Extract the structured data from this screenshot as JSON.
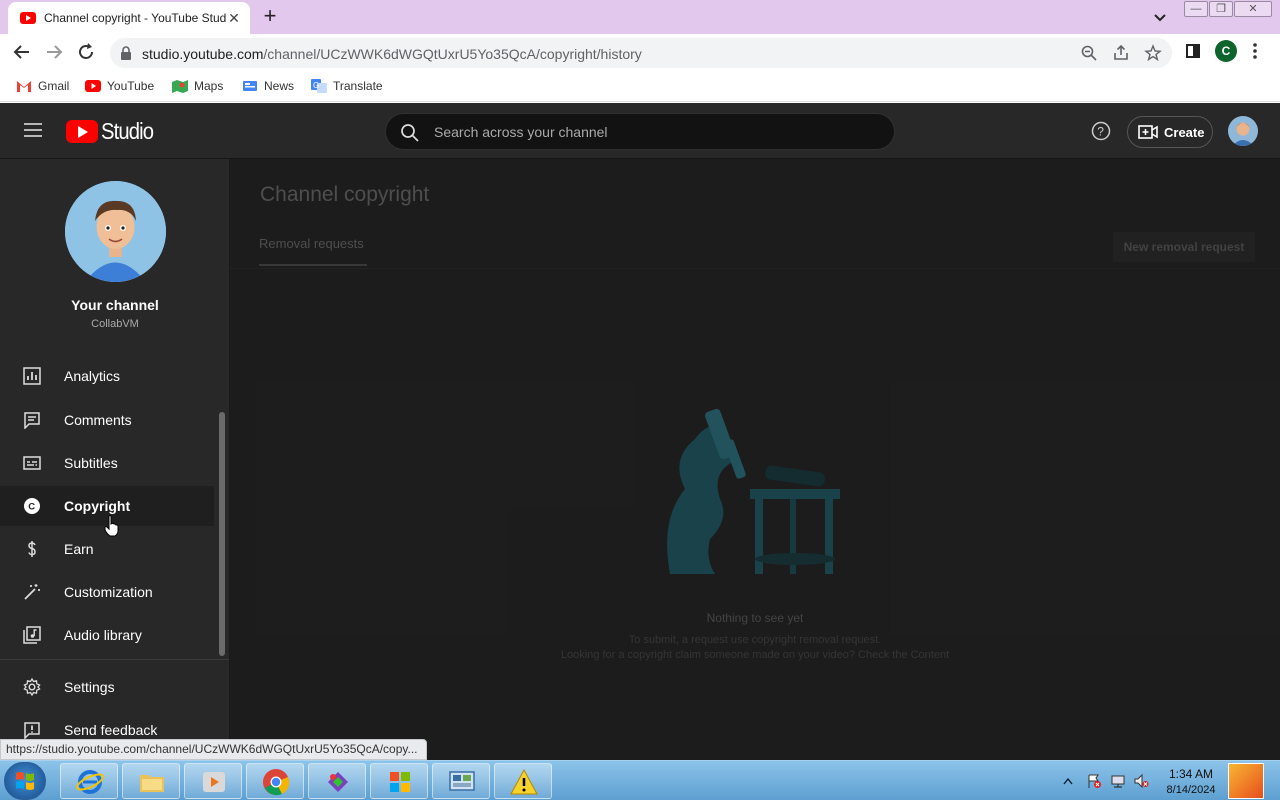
{
  "browser": {
    "tab_title": "Channel copyright - YouTube Studio",
    "url_host": "studio.youtube.com",
    "url_path": "/channel/UCzWWK6dWGQtUxrU5Yo35QcA/copyright/history",
    "profile_initial": "C",
    "bookmarks": [
      {
        "label": "Gmail",
        "icon": "gmail-icon"
      },
      {
        "label": "YouTube",
        "icon": "youtube-icon"
      },
      {
        "label": "Maps",
        "icon": "maps-icon"
      },
      {
        "label": "News",
        "icon": "news-icon"
      },
      {
        "label": "Translate",
        "icon": "translate-icon"
      }
    ],
    "status_url": "https://studio.youtube.com/channel/UCzWWK6dWGQtUxrU5Yo35QcA/copy..."
  },
  "studio": {
    "logo_text": "Studio",
    "search_placeholder": "Search across your channel",
    "create_label": "Create",
    "channel": {
      "name": "Your channel",
      "handle": "CollabVM"
    },
    "nav": [
      {
        "label": "Analytics",
        "icon": "analytics-icon"
      },
      {
        "label": "Comments",
        "icon": "comments-icon"
      },
      {
        "label": "Subtitles",
        "icon": "subtitles-icon"
      },
      {
        "label": "Copyright",
        "icon": "copyright-icon",
        "active": true
      },
      {
        "label": "Earn",
        "icon": "dollar-icon"
      },
      {
        "label": "Customization",
        "icon": "magic-wand-icon"
      },
      {
        "label": "Audio library",
        "icon": "audio-library-icon"
      }
    ],
    "nav_bottom": [
      {
        "label": "Settings",
        "icon": "gear-icon"
      },
      {
        "label": "Send feedback",
        "icon": "feedback-icon"
      }
    ],
    "page_title": "Channel copyright",
    "tab_label": "Removal requests",
    "new_request_label": "New removal request",
    "empty": {
      "title": "Nothing to see yet",
      "line1": "To submit, a request use copyright removal request.",
      "line2": "Looking for a copyright claim someone made on your video? Check the Content"
    }
  },
  "taskbar": {
    "time": "1:34 AM",
    "date": "8/14/2024",
    "apps": [
      "internet-explorer-icon",
      "file-explorer-icon",
      "media-player-icon",
      "chrome-icon",
      "paint-icon",
      "windows-icon",
      "control-panel-icon",
      "warning-icon"
    ]
  },
  "colors": {
    "studio_bg": "#1f1f1f",
    "sidebar_bg": "#282828",
    "youtube_red": "#ff0000",
    "titlebar": "#e3c8ee"
  }
}
